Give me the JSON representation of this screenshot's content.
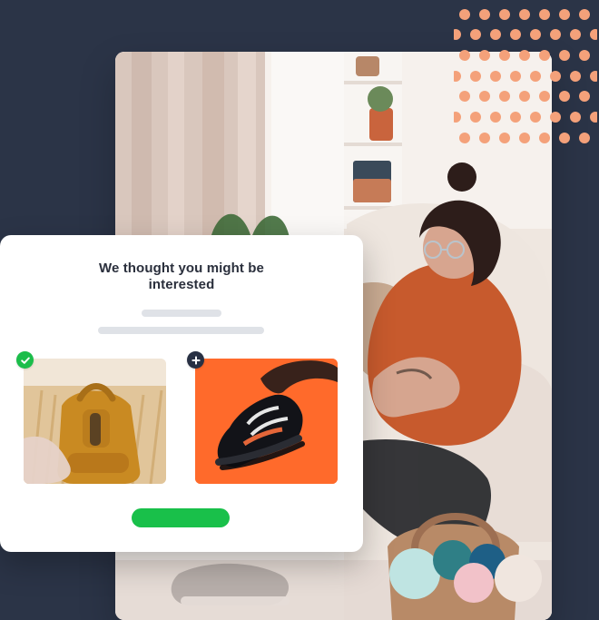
{
  "colors": {
    "page_background": "#2b3447",
    "card_background": "#ffffff",
    "accent_green": "#19c04a",
    "dot_orange": "#f4a17a",
    "product_orange": "#ff6a2b"
  },
  "popup": {
    "title": "We thought you might be interested",
    "products": [
      {
        "icon": "check-icon",
        "image": "yellow backpack",
        "selected": true
      },
      {
        "icon": "plus-icon",
        "image": "black and orange sneaker",
        "selected": false
      }
    ],
    "cta": {
      "label": ""
    }
  },
  "hero": {
    "image": "woman reading on a sofa"
  }
}
